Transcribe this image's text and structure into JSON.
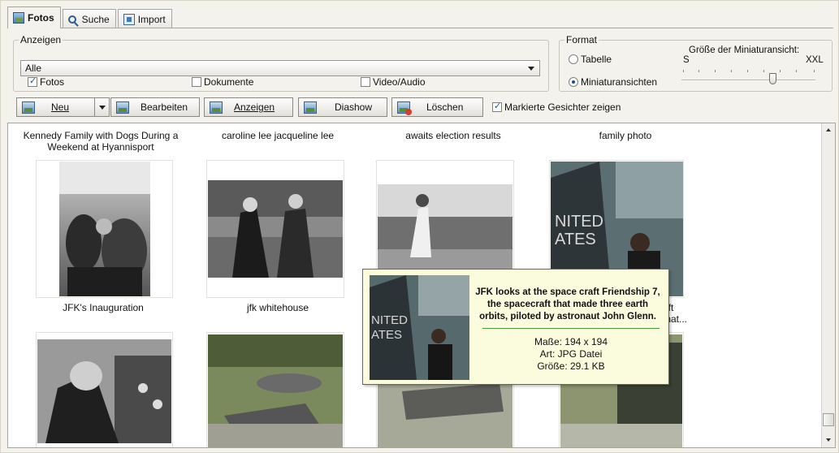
{
  "tabs": [
    {
      "label": "Fotos",
      "icon": "photo-icon",
      "active": true
    },
    {
      "label": "Suche",
      "icon": "search-icon",
      "active": false
    },
    {
      "label": "Import",
      "icon": "import-icon",
      "active": false
    }
  ],
  "anzeigen": {
    "group_label": "Anzeigen",
    "combo_value": "Alle",
    "filters": [
      {
        "label": "Fotos",
        "checked": true
      },
      {
        "label": "Dokumente",
        "checked": false
      },
      {
        "label": "Video/Audio",
        "checked": false
      }
    ]
  },
  "format": {
    "group_label": "Format",
    "options": [
      {
        "label": "Tabelle",
        "selected": false
      },
      {
        "label": "Miniaturansichten",
        "selected": true
      }
    ],
    "slider": {
      "title": "Größe der Miniaturansicht:",
      "min_label": "S",
      "max_label": "XXL",
      "value": 0.68
    }
  },
  "toolbar": {
    "new": "Neu",
    "edit": "Bearbeiten",
    "show": "Anzeigen",
    "slideshow": "Diashow",
    "delete": "Löschen",
    "faces": {
      "label": "Markierte Gesichter zeigen",
      "checked": true
    }
  },
  "grid": {
    "top_captions": [
      "Kennedy Family with Dogs During a Weekend at Hyannisport",
      "caroline lee jacqueline lee",
      "awaits election results",
      "family photo"
    ],
    "row1_captions": [
      "JFK's Inauguration",
      "jfk whitehouse",
      "",
      "aft that..."
    ]
  },
  "tooltip": {
    "description": "JFK looks at the space craft Friendship 7, the spacecraft that made three earth orbits, piloted by astronaut John Glenn.",
    "size": "Maße: 194 x 194",
    "type": "Art: JPG Datei",
    "filesize": "Größe: 29.1 KB"
  }
}
